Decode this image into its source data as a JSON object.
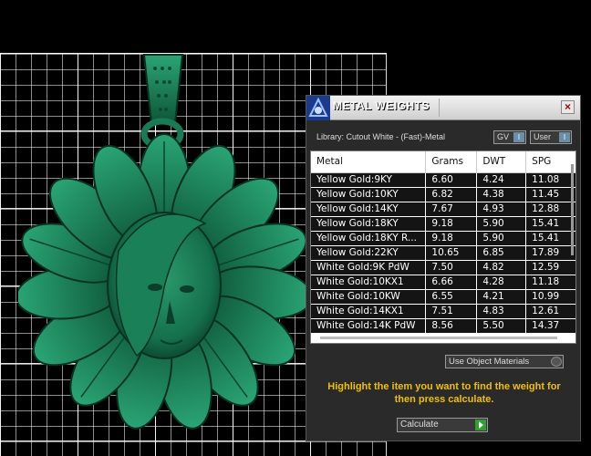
{
  "colors": {
    "pendant": "#1b7a56",
    "pendant_dark": "#0d4a33",
    "hint": "#f0c000"
  },
  "panel": {
    "title": "METAL WEIGHTS",
    "library": "Library: Cutout White - (Fast)-Metal",
    "gv_label": "GV",
    "user_label": "User",
    "columns": [
      "Metal",
      "Grams",
      "DWT",
      "SPG"
    ],
    "rows": [
      [
        "Yellow Gold:9KY",
        "6.60",
        "4.24",
        "11.08"
      ],
      [
        "Yellow Gold:10KY",
        "6.82",
        "4.38",
        "11.45"
      ],
      [
        "Yellow Gold:14KY",
        "7.67",
        "4.93",
        "12.88"
      ],
      [
        "Yellow Gold:18KY",
        "9.18",
        "5.90",
        "15.41"
      ],
      [
        "Yellow Gold:18KY R...",
        "9.18",
        "5.90",
        "15.41"
      ],
      [
        "Yellow Gold:22KY",
        "10.65",
        "6.85",
        "17.89"
      ],
      [
        "White Gold:9K PdW",
        "7.50",
        "4.82",
        "12.59"
      ],
      [
        "White Gold:10KX1",
        "6.66",
        "4.28",
        "11.18"
      ],
      [
        "White Gold:10KW",
        "6.55",
        "4.21",
        "10.99"
      ],
      [
        "White Gold:14KX1",
        "7.51",
        "4.83",
        "12.61"
      ],
      [
        "White Gold:14K PdW",
        "8.56",
        "5.50",
        "14.37"
      ]
    ],
    "materials_select": "Use Object Materials",
    "hint": "Highlight the item you want to find the weight for then press calculate.",
    "calculate_label": "Calculate"
  }
}
